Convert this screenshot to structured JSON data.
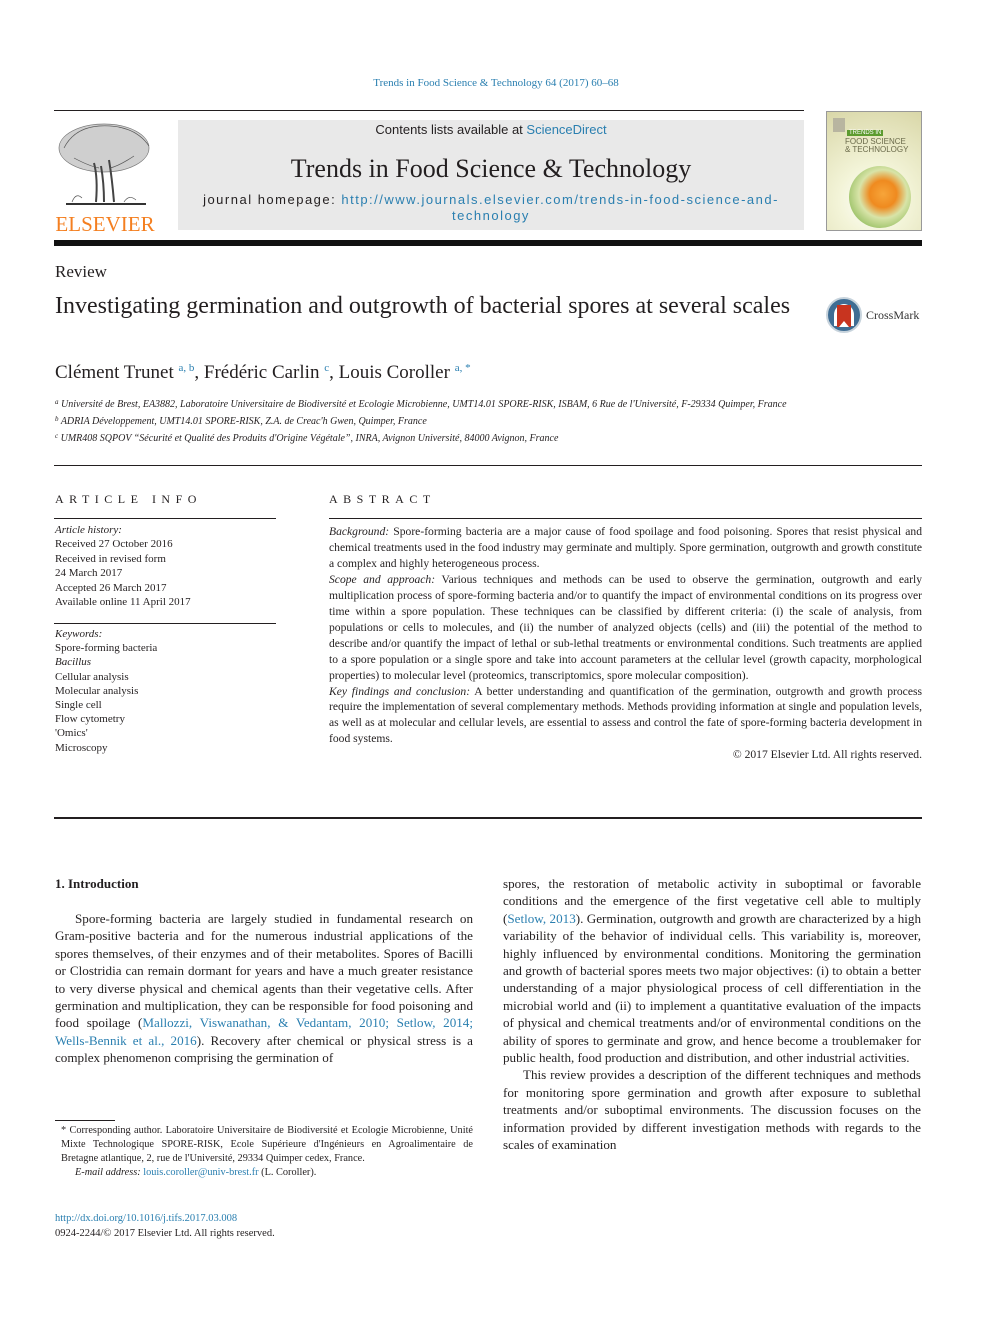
{
  "running_head": "Trends in Food Science & Technology 64 (2017) 60–68",
  "masthead": {
    "contents_prefix": "Contents lists available at ",
    "contents_link": "ScienceDirect",
    "journal_name": "Trends in Food Science & Technology",
    "homepage_prefix": "journal homepage: ",
    "homepage_url": "http://www.journals.elsevier.com/trends-in-food-science-and-technology"
  },
  "publisher": {
    "wordmark": "ELSEVIER"
  },
  "cover": {
    "tag": "TRENDS IN",
    "title_line1": "FOOD SCIENCE",
    "title_line2": "& TECHNOLOGY"
  },
  "crossmark": {
    "label": "CrossMark"
  },
  "article": {
    "type": "Review",
    "title": "Investigating germination and outgrowth of bacterial spores at several scales",
    "authors": [
      {
        "name": "Clément Trunet",
        "sup": "a, b",
        "sep": ", "
      },
      {
        "name": "Frédéric Carlin",
        "sup": "c",
        "sep": ", "
      },
      {
        "name": "Louis Coroller",
        "sup": "a, *",
        "sep": ""
      }
    ],
    "affiliations": [
      {
        "key": "a",
        "text": "Université de Brest, EA3882, Laboratoire Universitaire de Biodiversité et Ecologie Microbienne, UMT14.01 SPORE-RISK, ISBAM, 6 Rue de l'Université, F-29334 Quimper, France"
      },
      {
        "key": "b",
        "text": "ADRIA Développement, UMT14.01 SPORE-RISK, Z.A. de Creac'h Gwen, Quimper, France"
      },
      {
        "key": "c",
        "text": "UMR408 SQPOV “Sécurité et Qualité des Produits d'Origine Végétale”, INRA, Avignon Université, 84000 Avignon, France"
      }
    ]
  },
  "article_info": {
    "heading": "ARTICLE INFO",
    "history_label": "Article history:",
    "history": [
      "Received 27 October 2016",
      "Received in revised form",
      "24 March 2017",
      "Accepted 26 March 2017",
      "Available online 11 April 2017"
    ],
    "keywords_label": "Keywords:",
    "keywords": [
      {
        "text": "Spore-forming bacteria",
        "italic": false
      },
      {
        "text": "Bacillus",
        "italic": true
      },
      {
        "text": "Cellular analysis",
        "italic": false
      },
      {
        "text": "Molecular analysis",
        "italic": false
      },
      {
        "text": "Single cell",
        "italic": false
      },
      {
        "text": "Flow cytometry",
        "italic": false
      },
      {
        "text": "'Omics'",
        "italic": false
      },
      {
        "text": "Microscopy",
        "italic": false
      }
    ]
  },
  "abstract": {
    "heading": "ABSTRACT",
    "sections": [
      {
        "label": "Background:",
        "text": " Spore-forming bacteria are a major cause of food spoilage and food poisoning. Spores that resist physical and chemical treatments used in the food industry may germinate and multiply. Spore germination, outgrowth and growth constitute a complex and highly heterogeneous process."
      },
      {
        "label": "Scope and approach:",
        "text": " Various techniques and methods can be used to observe the germination, outgrowth and early multiplication process of spore-forming bacteria and/or to quantify the impact of environmental conditions on its progress over time within a spore population. These techniques can be classified by different criteria: (i) the scale of analysis, from populations or cells to molecules, and (ii) the number of analyzed objects (cells) and (iii) the potential of the method to describe and/or quantify the impact of lethal or sub-lethal treatments or environmental conditions. Such treatments are applied to a spore population or a single spore and take into account parameters at the cellular level (growth capacity, morphological properties) to molecular level (proteomics, transcriptomics, spore molecular composition)."
      },
      {
        "label": "Key findings and conclusion:",
        "text": "  A better understanding and quantification of the germination, outgrowth and growth process require the implementation of several complementary methods. Methods providing information at single and population levels, as well as at molecular and cellular levels, are essential to assess and control the fate of spore-forming bacteria development in food systems."
      }
    ],
    "copyright": "© 2017 Elsevier Ltd. All rights reserved."
  },
  "introduction": {
    "heading": "1.  Introduction",
    "left_p1_a": "Spore-forming bacteria are largely studied in fundamental research on Gram-positive bacteria and for the numerous industrial applications of the spores themselves, of their enzymes and of their metabolites. Spores of Bacilli or Clostridia can remain dormant for years and have a much greater resistance to very diverse physical and chemical agents than their vegetative cells. After germination and multiplication, they can be responsible for food poisoning and food spoilage (",
    "left_p1_cite": "Mallozzi, Viswanathan, & Vedantam, 2010; Setlow, 2014; Wells-Bennik et al., 2016",
    "left_p1_b": "). Recovery after chemical or physical stress is a complex phenomenon comprising the germination of",
    "right_p1_a": "spores, the restoration of metabolic activity in suboptimal or favorable conditions and the emergence of the first vegetative cell able to multiply (",
    "right_p1_cite": "Setlow, 2013",
    "right_p1_b": "). Germination, outgrowth and growth are characterized by a high variability of the behavior of individual cells. This variability is, moreover, highly influenced by environmental conditions. Monitoring the germination and growth of bacterial spores meets two major objectives: (i) to obtain a better understanding of a major physiological process of cell differentiation in the microbial world and (ii) to implement a quantitative evaluation of the impacts of physical and chemical treatments and/or of environmental conditions on the ability of spores to germinate and grow, and hence become a troublemaker for public health, food production and distribution, and other industrial activities.",
    "right_p2": "This review provides a description of the different techniques and methods for monitoring spore germination and growth after exposure to sublethal treatments and/or suboptimal environments. The discussion focuses on the information provided by different investigation methods with regards to the scales of examination"
  },
  "footnote": {
    "corresponding": "* Corresponding author. Laboratoire Universitaire de Biodiversité et Ecologie Microbienne, Unité Mixte Technologique SPORE-RISK, Ecole Supérieure d'Ingénieurs en Agroalimentaire de Bretagne atlantique, 2, rue de l'Université, 29334 Quimper cedex, France.",
    "email_label": "E-mail address:",
    "email": "louis.coroller@univ-brest.fr",
    "email_suffix": " (L. Coroller)."
  },
  "doi": {
    "url": "http://dx.doi.org/10.1016/j.tifs.2017.03.008",
    "issn_line": "0924-2244/© 2017 Elsevier Ltd. All rights reserved."
  },
  "colors": {
    "link": "#2a7fb0",
    "elsevier_orange": "#f47f20",
    "masthead_bg": "#e9e9e9",
    "text": "#231f20"
  }
}
